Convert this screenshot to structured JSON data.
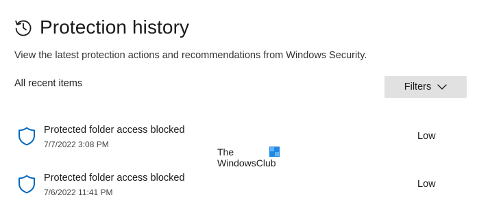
{
  "header": {
    "title": "Protection history",
    "icon": "history-icon",
    "subtitle": "View the latest protection actions and recommendations from Windows Security."
  },
  "list": {
    "section_label": "All recent items",
    "filters_label": "Filters",
    "items": [
      {
        "icon": "shield-icon",
        "title": "Protected folder access blocked",
        "date": "7/7/2022 3:08 PM",
        "severity": "Low"
      },
      {
        "icon": "shield-icon",
        "title": "Protected folder access blocked",
        "date": "7/6/2022 11:41 PM",
        "severity": "Low"
      }
    ]
  },
  "watermark": {
    "line1": "The",
    "line2": "WindowsClub"
  },
  "colors": {
    "accent": "#0067c0",
    "button_bg": "#e1e1e1",
    "text": "#1a1a1a"
  }
}
